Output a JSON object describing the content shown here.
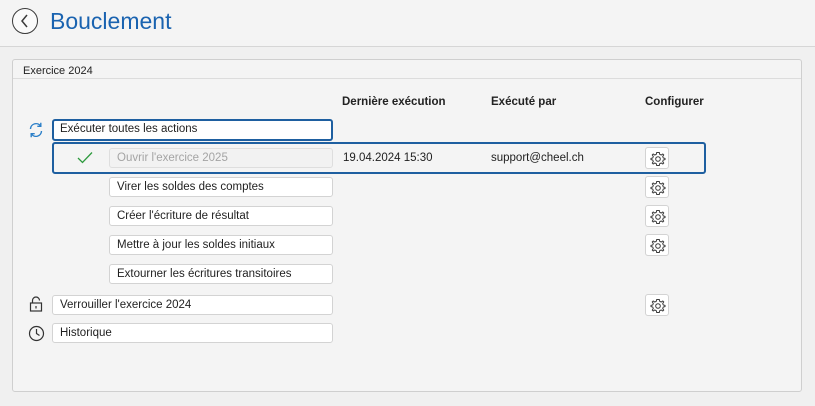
{
  "header": {
    "title": "Bouclement",
    "back_icon": "chevron-left-icon"
  },
  "group": {
    "title": "Exercice 2024"
  },
  "columns": {
    "last_run": "Dernière exécution",
    "executed_by": "Exécuté par",
    "configure": "Configurer"
  },
  "actions": {
    "run_all": {
      "label": "Exécuter toutes les actions",
      "icon": "refresh-icon"
    },
    "open_year": {
      "label": "Ouvrir l'exercice 2025",
      "status_icon": "checkmark-icon",
      "last_run": "19.04.2024 15:30",
      "executed_by": "support@cheel.ch"
    },
    "transfer_balances": {
      "label": "Virer les soldes des comptes"
    },
    "create_result_entry": {
      "label": "Créer l'écriture de résultat"
    },
    "update_opening_balances": {
      "label": "Mettre à jour les soldes initiaux"
    },
    "reverse_transitory": {
      "label": "Extourner les écritures transitoires"
    },
    "lock_year": {
      "label": "Verrouiller l'exercice 2024",
      "icon": "lock-icon"
    },
    "history": {
      "label": "Historique",
      "icon": "clock-icon"
    }
  },
  "colors": {
    "accent": "#1e5fa0",
    "title": "#1a63b0",
    "check": "#2e9a3e"
  }
}
